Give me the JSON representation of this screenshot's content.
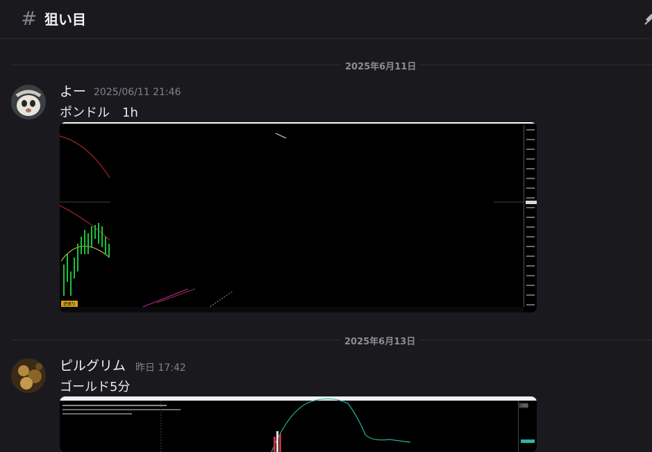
{
  "channel": {
    "hash": "#",
    "name": "狙い目",
    "icon": "pin-icon"
  },
  "dividers": [
    {
      "label": "2025年6月11日"
    },
    {
      "label": "2025年6月13日"
    }
  ],
  "messages": [
    {
      "author": "よー",
      "timestamp": "2025/06/11 21:46",
      "text": "ポンドル　1h",
      "attachment": {
        "badge": "逆張り"
      }
    },
    {
      "author": "ピルグリム",
      "timestamp": "昨日 17:42",
      "text": "ゴールド5分",
      "attachment": {
        "badge": "USD"
      }
    }
  ],
  "colors": {
    "background": "#1a1a1e",
    "text_muted": "#80848e",
    "chart_candle_green": "#19c43a",
    "chart_line_teal": "#2ab6a3",
    "chart_magenta": "#c21fa8"
  }
}
